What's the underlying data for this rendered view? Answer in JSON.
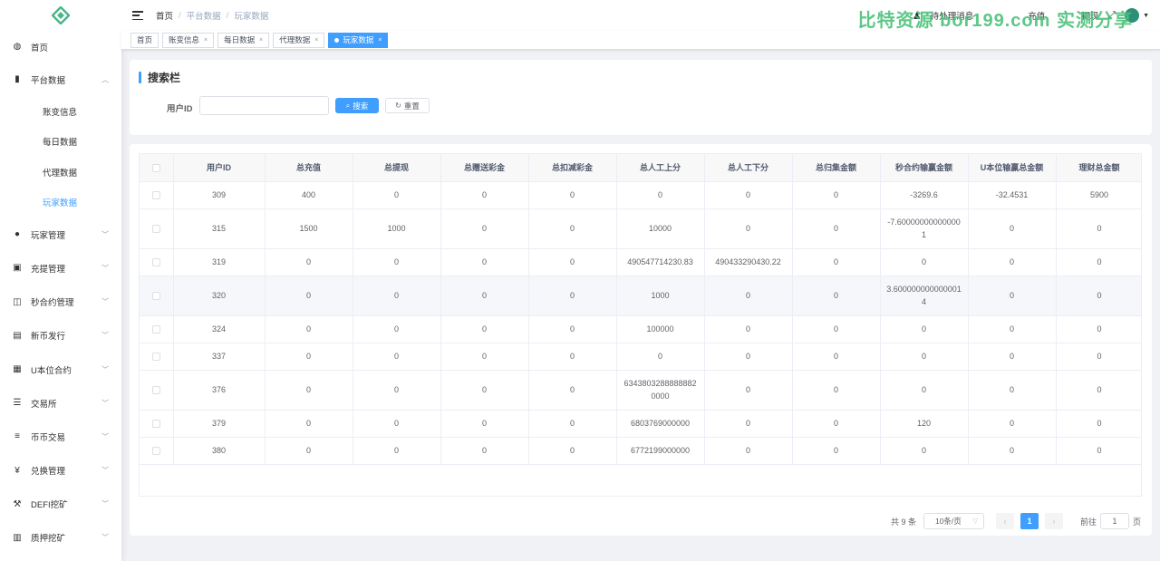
{
  "sidebar": {
    "items": [
      {
        "label": "首页",
        "icon": "dashboard-icon",
        "glyph": "◍",
        "has_arrow": false
      },
      {
        "label": "平台数据",
        "icon": "book-icon",
        "glyph": "▮",
        "has_arrow": true,
        "expanded": true,
        "children": [
          "账变信息",
          "每日数据",
          "代理数据",
          "玩家数据"
        ],
        "active_child": 3
      },
      {
        "label": "玩家管理",
        "icon": "user-icon",
        "glyph": "●",
        "has_arrow": true
      },
      {
        "label": "充提管理",
        "icon": "copy-icon",
        "glyph": "▣",
        "has_arrow": true
      },
      {
        "label": "秒合约管理",
        "icon": "monitor-icon",
        "glyph": "◫",
        "has_arrow": true
      },
      {
        "label": "新币发行",
        "icon": "card-icon",
        "glyph": "▤",
        "has_arrow": true
      },
      {
        "label": "U本位合约",
        "icon": "grid-icon",
        "glyph": "▦",
        "has_arrow": true
      },
      {
        "label": "交易所",
        "icon": "list-icon",
        "glyph": "☰",
        "has_arrow": true
      },
      {
        "label": "币币交易",
        "icon": "bullet-list-icon",
        "glyph": "≡",
        "has_arrow": true
      },
      {
        "label": "兑换管理",
        "icon": "yen-icon",
        "glyph": "¥",
        "has_arrow": true
      },
      {
        "label": "DEFI挖矿",
        "icon": "pickaxe-icon",
        "glyph": "⚒",
        "has_arrow": true
      },
      {
        "label": "质押挖矿",
        "icon": "bar-chart-icon",
        "glyph": "▥",
        "has_arrow": true
      }
    ]
  },
  "header": {
    "breadcrumb": [
      "首页",
      "平台数据",
      "玩家数据"
    ],
    "right_links": [
      "待处理消息",
      "充值",
      "提现"
    ],
    "watermark": "比特资源 bor199.com 实测分享"
  },
  "tags": [
    {
      "label": "首页",
      "closable": false,
      "active": false
    },
    {
      "label": "账变信息",
      "closable": true,
      "active": false
    },
    {
      "label": "每日数据",
      "closable": true,
      "active": false
    },
    {
      "label": "代理数据",
      "closable": true,
      "active": false
    },
    {
      "label": "玩家数据",
      "closable": true,
      "active": true
    }
  ],
  "search": {
    "title": "搜索栏",
    "field_label": "用户ID",
    "field_value": "",
    "search_button": "搜索",
    "reset_button": "重置"
  },
  "table": {
    "columns": [
      "用户ID",
      "总充值",
      "总提现",
      "总赠送彩金",
      "总扣减彩金",
      "总人工上分",
      "总人工下分",
      "总归集金额",
      "秒合约输赢金额",
      "U本位输赢总金额",
      "理财总金额"
    ],
    "rows": [
      [
        "309",
        "400",
        "0",
        "0",
        "0",
        "0",
        "0",
        "0",
        "-3269.6",
        "-32.4531",
        "5900"
      ],
      [
        "315",
        "1500",
        "1000",
        "0",
        "0",
        "10000",
        "0",
        "0",
        "-7.600000000000001",
        "0",
        "0"
      ],
      [
        "319",
        "0",
        "0",
        "0",
        "0",
        "490547714230.83",
        "490433290430.22",
        "0",
        "0",
        "0",
        "0"
      ],
      [
        "320",
        "0",
        "0",
        "0",
        "0",
        "1000",
        "0",
        "0",
        "3.6000000000000014",
        "0",
        "0"
      ],
      [
        "324",
        "0",
        "0",
        "0",
        "0",
        "100000",
        "0",
        "0",
        "0",
        "0",
        "0"
      ],
      [
        "337",
        "0",
        "0",
        "0",
        "0",
        "0",
        "0",
        "0",
        "0",
        "0",
        "0"
      ],
      [
        "376",
        "0",
        "0",
        "0",
        "0",
        "63438032888888820000",
        "0",
        "0",
        "0",
        "0",
        "0"
      ],
      [
        "379",
        "0",
        "0",
        "0",
        "0",
        "6803769000000",
        "0",
        "0",
        "120",
        "0",
        "0"
      ],
      [
        "380",
        "0",
        "0",
        "0",
        "0",
        "6772199000000",
        "0",
        "0",
        "0",
        "0",
        "0"
      ]
    ],
    "highlight_row": 3
  },
  "pagination": {
    "total": "共 9 条",
    "page_size": "10条/页",
    "current_page": "1",
    "goto_prefix": "前往",
    "goto_value": "1",
    "goto_suffix": "页"
  },
  "colors": {
    "primary": "#409eff",
    "logo": "#4cb58a",
    "watermark": "#4cc27b"
  }
}
